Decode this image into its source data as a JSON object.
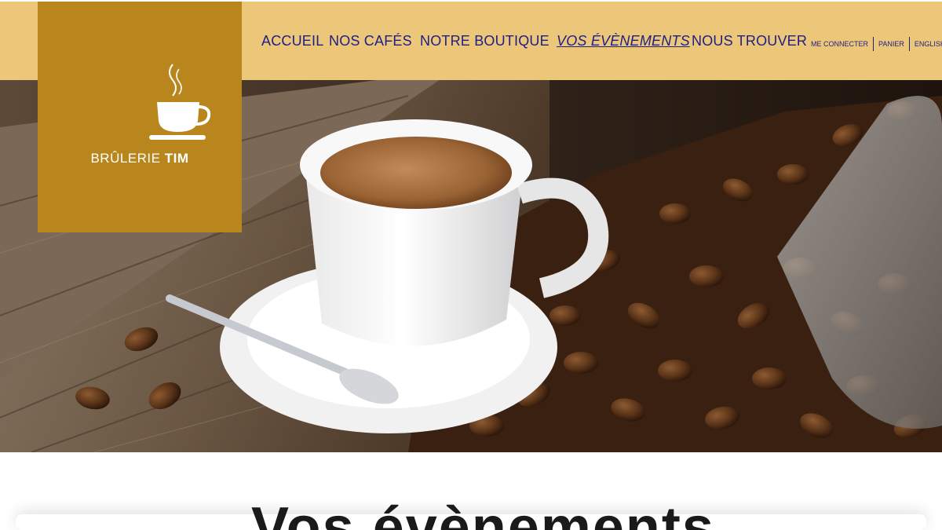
{
  "brand": {
    "name_part1": "BRÛLERIE",
    "name_part2": "TIM",
    "logo_icon": "coffee-cup-icon",
    "color": "#b8861c"
  },
  "nav": {
    "items": [
      {
        "label": "ACCUEIL",
        "active": false
      },
      {
        "label": "NOS CAFÉS",
        "active": false
      },
      {
        "label": "NOTRE BOUTIQUE",
        "active": false
      },
      {
        "label": "VOS ÉVÈNEMENTS",
        "active": true
      },
      {
        "label": "NOUS TROUVER",
        "active": false
      }
    ],
    "color": "#1d1f86"
  },
  "utility": {
    "login": "ME CONNECTER",
    "cart": "PANIER",
    "language": "ENGLISH"
  },
  "header": {
    "background": "#ecc679"
  },
  "main": {
    "heading": "Vos évènements"
  }
}
